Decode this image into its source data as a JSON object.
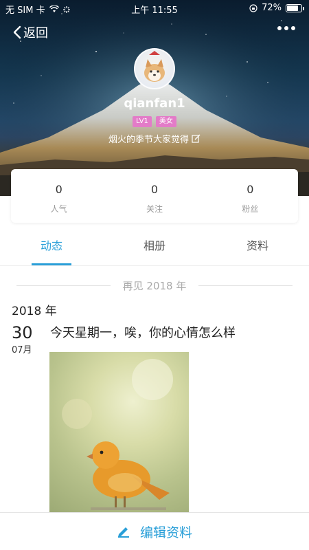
{
  "status_bar": {
    "carrier": "无 SIM 卡",
    "time": "上午 11:55",
    "battery": "72%"
  },
  "nav": {
    "back_label": "返回"
  },
  "profile": {
    "username": "qianfan1",
    "level_badge": "LV1",
    "gender_badge": "美女",
    "signature": "烟火的季节大家觉得"
  },
  "stats": [
    {
      "value": "0",
      "label": "人气"
    },
    {
      "value": "0",
      "label": "关注"
    },
    {
      "value": "0",
      "label": "粉丝"
    }
  ],
  "tabs": [
    {
      "label": "动态",
      "active": true
    },
    {
      "label": "相册",
      "active": false
    },
    {
      "label": "资料",
      "active": false
    }
  ],
  "feed": {
    "divider_text": "再见 2018 年",
    "year_label": "2018 年",
    "post": {
      "day": "30",
      "month": "07月",
      "text": "今天星期一，唉，你的心情怎么样"
    }
  },
  "bottom_bar": {
    "label": "编辑资料"
  },
  "colors": {
    "accent": "#2a9fd8",
    "badge": "#e37bc8"
  },
  "icons": {
    "back": "chevron-left-icon",
    "more": "more-dots-icon",
    "edit_signature": "edit-icon",
    "edit_profile": "pencil-icon"
  }
}
